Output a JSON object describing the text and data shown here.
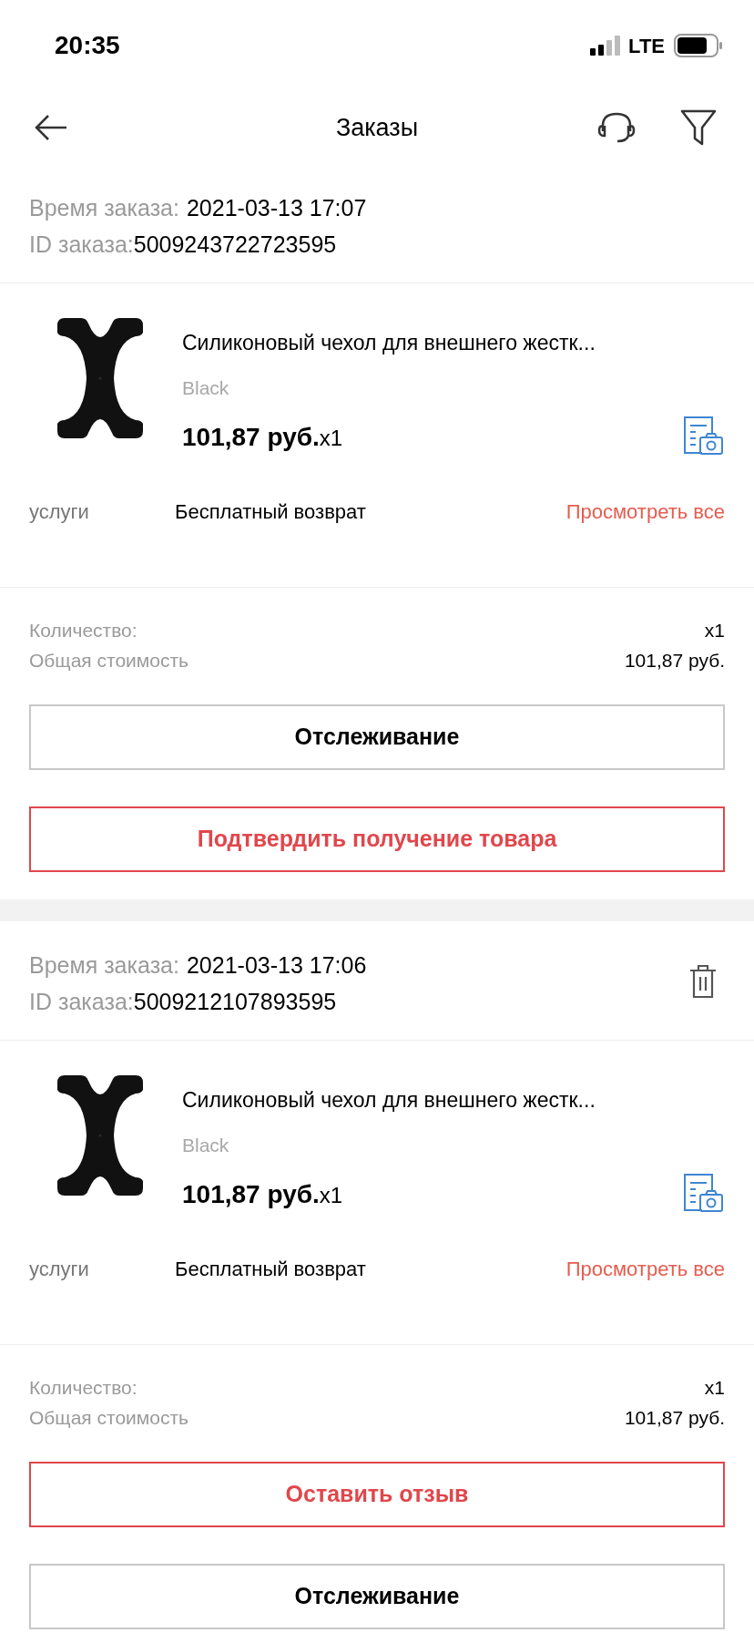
{
  "status_bar": {
    "time": "20:35",
    "network": "LTE"
  },
  "nav": {
    "title": "Заказы"
  },
  "orders": [
    {
      "time_label": "Время заказа:",
      "time": "2021-03-13 17:07",
      "id_label": "ID заказа:",
      "id": "5009243722723595",
      "deletable": false,
      "product": {
        "title": "Силиконовый чехол для внешнего жестк...",
        "variant": "Black",
        "price": "101,87 руб.",
        "qty": "x1"
      },
      "services": {
        "label": "услуги",
        "value": "Бесплатный возврат",
        "link": "Просмотреть все"
      },
      "quantity_label": "Количество:",
      "quantity": "x1",
      "total_label": "Общая стоимость",
      "total": "101,87 руб.",
      "buttons": [
        {
          "label": "Отслеживание",
          "kind": "neutral"
        },
        {
          "label": "Подтвердить получение товара",
          "kind": "accent"
        }
      ]
    },
    {
      "time_label": "Время заказа:",
      "time": "2021-03-13 17:06",
      "id_label": "ID заказа:",
      "id": "5009212107893595",
      "deletable": true,
      "product": {
        "title": "Силиконовый чехол для внешнего жестк...",
        "variant": "Black",
        "price": "101,87 руб.",
        "qty": "x1"
      },
      "services": {
        "label": "услуги",
        "value": "Бесплатный возврат",
        "link": "Просмотреть все"
      },
      "quantity_label": "Количество:",
      "quantity": "x1",
      "total_label": "Общая стоимость",
      "total": "101,87 руб.",
      "buttons": [
        {
          "label": "Оставить отзыв",
          "kind": "accent"
        },
        {
          "label": "Отслеживание",
          "kind": "neutral"
        }
      ]
    }
  ]
}
